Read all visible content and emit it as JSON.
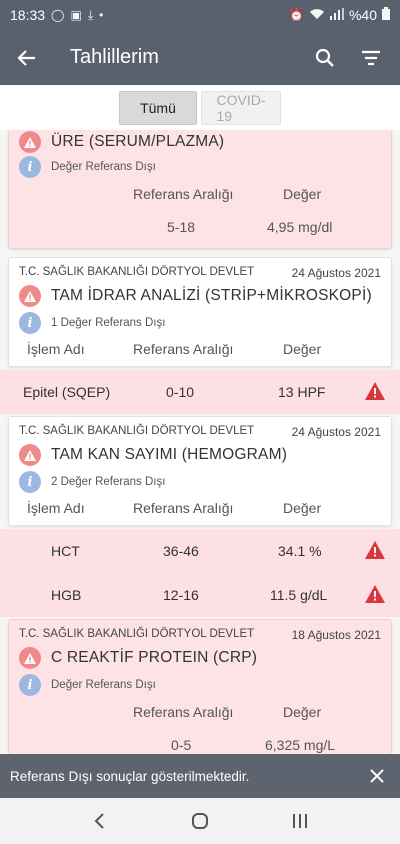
{
  "status_bar": {
    "time": "18:33",
    "battery": "%40"
  },
  "app_bar": {
    "title": "Tahlillerim",
    "icons": [
      "back-arrow-icon",
      "search-icon",
      "filter-icon"
    ]
  },
  "tabs": [
    {
      "label": "Tümü",
      "active": true
    },
    {
      "label": "COVID-19",
      "active": false
    }
  ],
  "columns": {
    "islem": "İşlem Adı",
    "referans": "Referans Aralığı",
    "deger": "Değer"
  },
  "cards": [
    {
      "hospital": "",
      "date": "",
      "test": "ÜRE (SERUM/PLAZMA)",
      "info": "Değer Referans Dışı",
      "range": "5-18",
      "value": "4,95 mg/dl"
    },
    {
      "hospital": "T.C. SAĞLIK BAKANLIĞI DÖRTYOL DEVLET",
      "date": "24 Ağustos 2021",
      "test": "TAM İDRAR ANALİZİ (STRİP+MİKROSKOPİ)",
      "info": "1 Değer Referans Dışı",
      "results": [
        {
          "name": "Epitel (SQEP)",
          "range": "0-10",
          "value": "13 HPF"
        }
      ]
    },
    {
      "hospital": "T.C. SAĞLIK BAKANLIĞI DÖRTYOL DEVLET",
      "date": "24 Ağustos 2021",
      "test": "TAM KAN SAYIMI (HEMOGRAM)",
      "info": "2 Değer Referans Dışı",
      "results": [
        {
          "name": "HCT",
          "range": "36-46",
          "value": "34.1 %"
        },
        {
          "name": "HGB",
          "range": "12-16",
          "value": "11.5 g/dL"
        }
      ]
    },
    {
      "hospital": "T.C. SAĞLIK BAKANLIĞI DÖRTYOL DEVLET",
      "date": "18 Ağustos 2021",
      "test": "C REAKTİF PROTEIN (CRP)",
      "info": "Değer Referans Dışı",
      "range": "0-5",
      "value": "6,325 mg/L"
    }
  ],
  "snackbar": {
    "message": "Referans Dışı sonuçlar gösterilmektedir."
  },
  "colors": {
    "appbar": "#59616e",
    "refout_bg": "#fde3e6",
    "warn": "#ee8a8a",
    "alert_red": "#d9363e",
    "info": "#9db8df"
  }
}
